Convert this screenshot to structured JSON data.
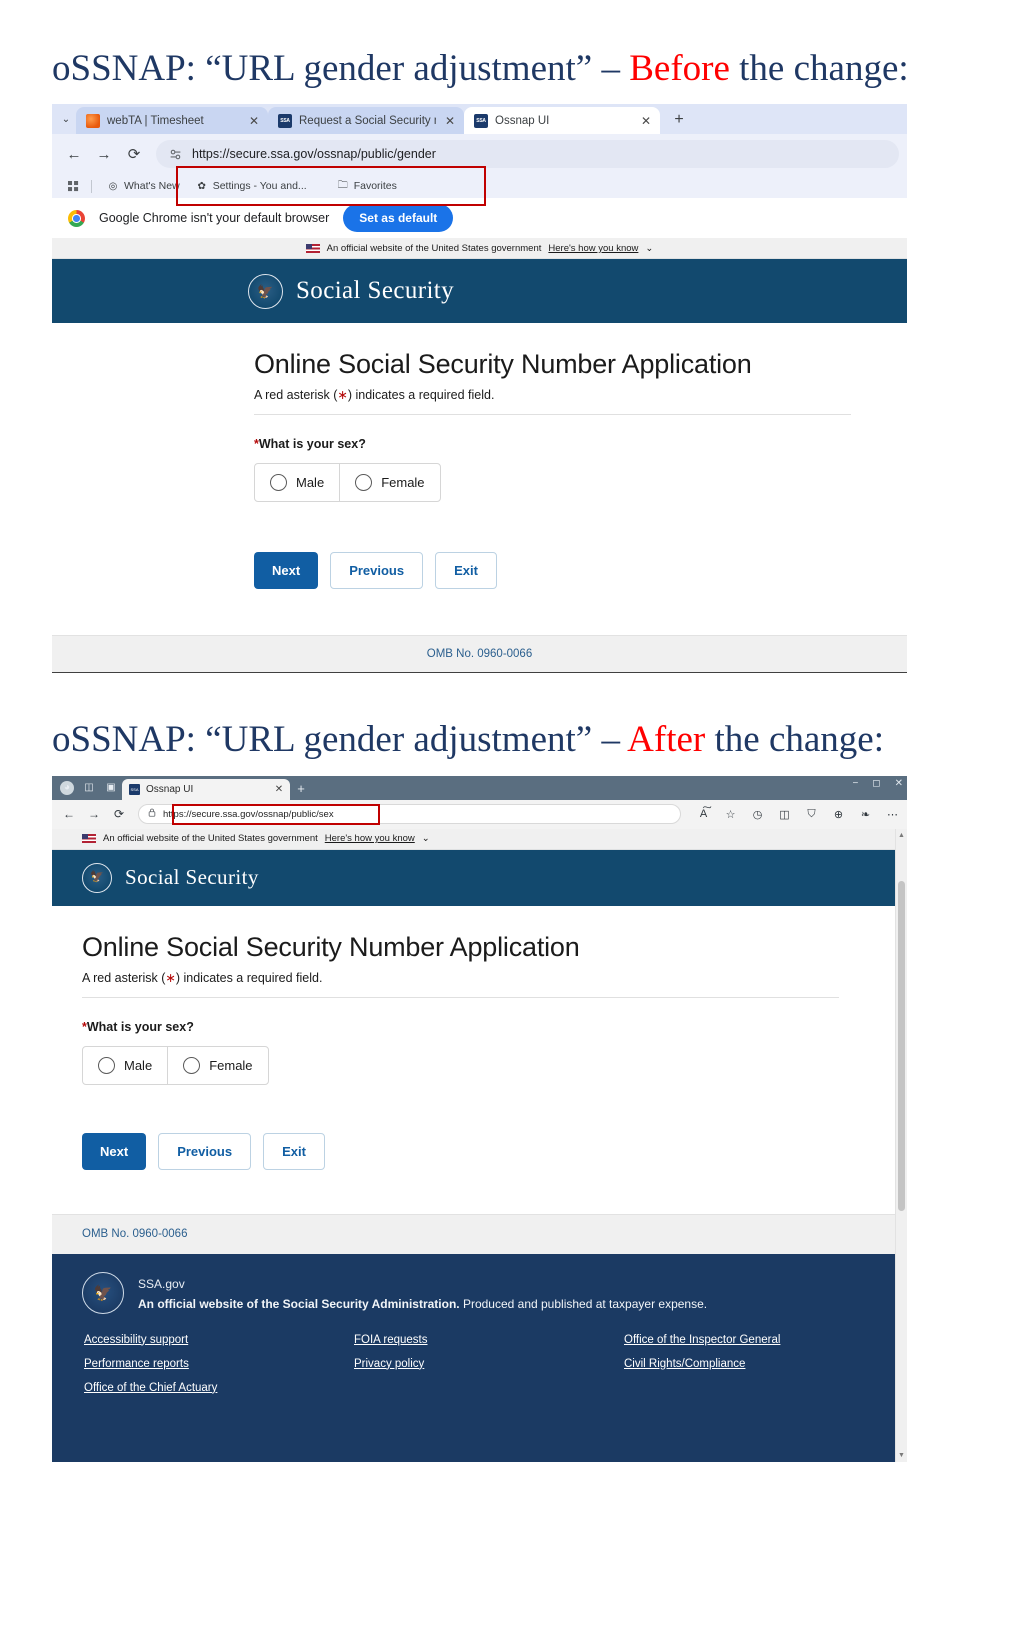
{
  "slide1": {
    "heading_part1": "oSSNAP: “URL gender adjustment” – ",
    "heading_highlight": "Before",
    "heading_part2": " the change:",
    "browser": {
      "name": "Google Chrome",
      "tabs": [
        {
          "title": "webTA | Timesheet",
          "favicon": "firefox-icon",
          "close": "✕",
          "active": false
        },
        {
          "title": "Request a Social Security numb",
          "favicon": "ssa-icon",
          "close": "✕",
          "active": false
        },
        {
          "title": "Ossnap UI",
          "favicon": "ssa-icon",
          "close": "✕",
          "active": true
        }
      ],
      "new_tab": "+",
      "tab_list_chevron": "⌄",
      "nav": {
        "back": "←",
        "forward": "→",
        "reload": "⟳"
      },
      "omnibox": {
        "url": "https://secure.ssa.gov/ossnap/public/gender",
        "site_icon": "page-settings-icon"
      },
      "bookmarks": {
        "apps_icon": "apps-grid-icon",
        "items": [
          {
            "label": "What's New",
            "icon": "shield-icon"
          },
          {
            "label": "Settings - You and...",
            "icon": "gear-icon"
          },
          {
            "label": "Favorites",
            "icon": "folder-icon"
          }
        ]
      },
      "default_bar": {
        "message": "Google Chrome isn't your default browser",
        "button": "Set as default"
      }
    }
  },
  "slide2": {
    "heading_part1": "oSSNAP: “URL gender adjustment” – ",
    "heading_highlight": "After",
    "heading_part2": " the change:",
    "browser": {
      "name": "Microsoft Edge",
      "title_icons": [
        "profile-avatar-icon",
        "split-screen-icon",
        "workspaces-icon"
      ],
      "tabs": [
        {
          "title": "Ossnap UI",
          "favicon": "ssa-icon",
          "close": "✕",
          "active": true
        }
      ],
      "new_tab": "+",
      "window_controls": [
        "−",
        "◻",
        "✕"
      ],
      "nav": {
        "back": "←",
        "forward": "→",
        "reload": "⟳"
      },
      "omnibox": {
        "url": "https://secure.ssa.gov/ossnap/public/sex",
        "site_icon": "lock-icon"
      },
      "right_icons": [
        "read-aloud-icon",
        "favorite-star-icon",
        "history-icon",
        "split-screen-icon",
        "collections-icon",
        "browser-essentials-icon",
        "copilot-icon",
        "settings-more-icon"
      ]
    }
  },
  "ssa_page": {
    "usa_banner": {
      "flag_icon": "us-flag-icon",
      "text": "An official website of the United States government",
      "link": "Here's how you know",
      "chevron": "⌄"
    },
    "header": {
      "seal_icon": "ssa-seal-icon",
      "wordmark": "Social Security"
    },
    "title": "Online Social Security Number Application",
    "subtitle_pre": "A red asterisk (",
    "subtitle_ast": "∗",
    "subtitle_post": ") indicates a required field.",
    "question": {
      "asterisk": "*",
      "label": "What is your sex?",
      "options": [
        {
          "label": "Male",
          "selected": false
        },
        {
          "label": "Female",
          "selected": false
        }
      ]
    },
    "buttons": [
      {
        "label": "Next",
        "style": "primary"
      },
      {
        "label": "Previous",
        "style": "outline"
      },
      {
        "label": "Exit",
        "style": "outline"
      }
    ],
    "omb": "OMB No. 0960-0066",
    "footer": {
      "seal_icon": "ssa-seal-icon",
      "ssa_gov": "SSA.gov",
      "tagline_bold": "An official website of the Social Security Administration.",
      "tagline_rest": " Produced and published at taxpayer expense.",
      "links": [
        "Accessibility support",
        "FOIA requests",
        "Office of the Inspector General",
        "Performance reports",
        "Privacy policy",
        "Civil Rights/Compliance",
        "Office of the Chief Actuary",
        "",
        ""
      ]
    }
  },
  "colors": {
    "heading_blue": "#1F3864",
    "heading_red": "#FF0000",
    "ssa_header_blue": "#12496E",
    "ssa_footer_blue": "#1B3A63",
    "primary_button": "#115EA3",
    "highlight_border": "#C00000",
    "chrome_accent": "#1A73E8"
  }
}
